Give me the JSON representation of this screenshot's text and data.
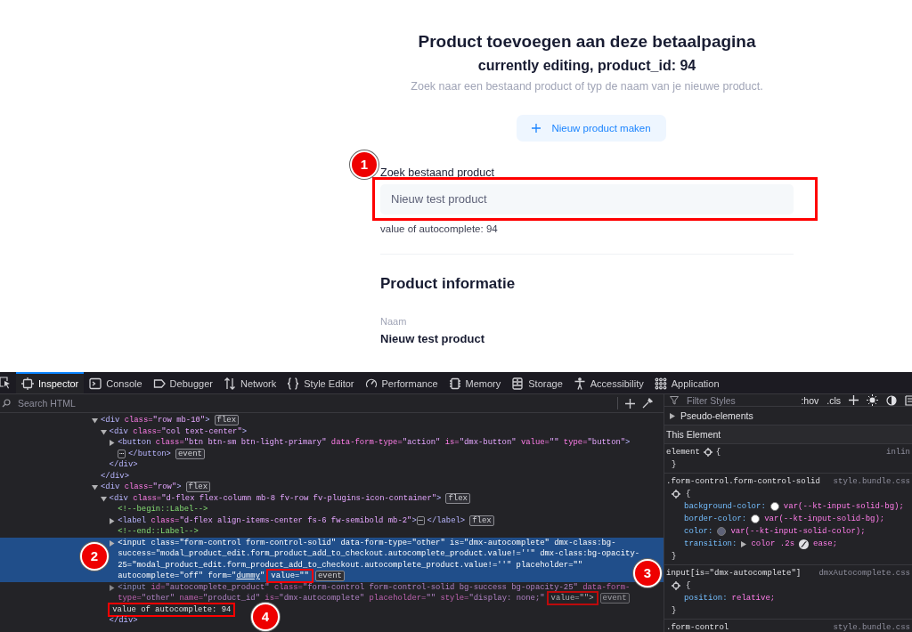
{
  "page": {
    "title": "Product toevoegen aan deze betaalpagina",
    "subtitle": "currently editing, product_id: 94",
    "description": "Zoek naar een bestaand product of typ de naam van je nieuwe product.",
    "new_button": "Nieuw product maken",
    "search_label": "Zoek bestaand product",
    "search_field": {
      "value": "Nieuw test product",
      "highlighted": true,
      "marker": "1"
    },
    "autocomplete_value": "value of autocomplete: 94",
    "section_title": "Product informatie",
    "name_label": "Naam",
    "name_value": "Nieuw test product"
  },
  "devtools": {
    "tabs": [
      {
        "kind": "inspector",
        "label": "Inspector",
        "selected": true
      },
      {
        "kind": "console",
        "label": "Console",
        "selected": false
      },
      {
        "kind": "debugger",
        "label": "Debugger",
        "selected": false
      },
      {
        "kind": "network",
        "label": "Network",
        "selected": false
      },
      {
        "kind": "style",
        "label": "Style Editor",
        "selected": false
      },
      {
        "kind": "performance",
        "label": "Performance",
        "selected": false
      },
      {
        "kind": "memory",
        "label": "Memory",
        "selected": false
      },
      {
        "kind": "storage",
        "label": "Storage",
        "selected": false
      },
      {
        "kind": "accessibility",
        "label": "Accessibility",
        "selected": false
      },
      {
        "kind": "application",
        "label": "Application",
        "selected": false
      }
    ],
    "search_placeholder": "Search HTML",
    "dom_tree": [
      {
        "kind": "element",
        "expanded": true,
        "selected": false,
        "hidden": false,
        "lines": [
          [
            {
              "kind": "tag",
              "text": "<div"
            },
            {
              "kind": "attr",
              "text": " class="
            },
            {
              "kind": "val",
              "text": "\"row mb-10\""
            },
            {
              "kind": "tag",
              "text": ">"
            },
            {
              "kind": "badge",
              "text": "flex"
            }
          ]
        ],
        "children": [
          {
            "kind": "element",
            "expanded": true,
            "selected": false,
            "hidden": false,
            "lines": [
              [
                {
                  "kind": "tag",
                  "text": "<div"
                },
                {
                  "kind": "attr",
                  "text": " class="
                },
                {
                  "kind": "val",
                  "text": "\"col text-center\""
                },
                {
                  "kind": "tag",
                  "text": ">"
                }
              ]
            ],
            "children": [
              {
                "kind": "element",
                "expanded": false,
                "selected": false,
                "hidden": false,
                "lines": [
                  [
                    {
                      "kind": "tag",
                      "text": "<button"
                    },
                    {
                      "kind": "attr",
                      "text": " class="
                    },
                    {
                      "kind": "val",
                      "text": "\"btn btn-sm btn-light-primary\""
                    },
                    {
                      "kind": "attr",
                      "text": " data-form-type="
                    },
                    {
                      "kind": "val",
                      "text": "\"action\""
                    },
                    {
                      "kind": "attr",
                      "text": " is="
                    },
                    {
                      "kind": "val",
                      "text": "\"dmx-button\""
                    },
                    {
                      "kind": "attr",
                      "text": " value="
                    },
                    {
                      "kind": "val",
                      "text": "\"\""
                    },
                    {
                      "kind": "attr",
                      "text": " type="
                    },
                    {
                      "kind": "val",
                      "text": "\"button\""
                    },
                    {
                      "kind": "tag",
                      "text": ">"
                    }
                  ],
                  [
                    {
                      "kind": "ellipsis",
                      "text": "⋯"
                    },
                    {
                      "kind": "tag",
                      "text": "</button>"
                    },
                    {
                      "kind": "badge",
                      "text": "event"
                    }
                  ]
                ]
              }
            ],
            "close": [
              {
                "kind": "tag",
                "text": "</div>"
              }
            ]
          }
        ],
        "close": [
          {
            "kind": "tag",
            "text": "</div>"
          }
        ]
      },
      {
        "kind": "element",
        "expanded": true,
        "selected": false,
        "hidden": false,
        "lines": [
          [
            {
              "kind": "tag",
              "text": "<div"
            },
            {
              "kind": "attr",
              "text": " class="
            },
            {
              "kind": "val",
              "text": "\"row\""
            },
            {
              "kind": "tag",
              "text": ">"
            },
            {
              "kind": "badge",
              "text": "flex"
            }
          ]
        ],
        "children": [
          {
            "kind": "element",
            "expanded": true,
            "selected": false,
            "hidden": false,
            "lines": [
              [
                {
                  "kind": "tag",
                  "text": "<div"
                },
                {
                  "kind": "attr",
                  "text": " class="
                },
                {
                  "kind": "val",
                  "text": "\"d-flex flex-column mb-8 fv-row fv-plugins-icon-container\""
                },
                {
                  "kind": "tag",
                  "text": ">"
                },
                {
                  "kind": "badge",
                  "text": "flex"
                }
              ]
            ],
            "children": [
              {
                "kind": "comment",
                "selected": false,
                "hidden": false,
                "lines": [
                  [
                    {
                      "kind": "comment",
                      "text": "<!--begin::Label-->"
                    }
                  ]
                ]
              },
              {
                "kind": "element",
                "expanded": false,
                "selected": false,
                "hidden": false,
                "lines": [
                  [
                    {
                      "kind": "tag",
                      "text": "<label"
                    },
                    {
                      "kind": "attr",
                      "text": " class="
                    },
                    {
                      "kind": "val",
                      "text": "\"d-flex align-items-center fs-6 fw-semibold mb-2\""
                    },
                    {
                      "kind": "tag",
                      "text": ">"
                    },
                    {
                      "kind": "ellipsis",
                      "text": "⋯"
                    },
                    {
                      "kind": "tag",
                      "text": "</label>"
                    },
                    {
                      "kind": "badge",
                      "text": "flex"
                    }
                  ]
                ]
              },
              {
                "kind": "comment",
                "selected": false,
                "hidden": false,
                "lines": [
                  [
                    {
                      "kind": "comment",
                      "text": "<!--end::Label-->"
                    }
                  ]
                ]
              },
              {
                "kind": "element",
                "expanded": false,
                "selected": true,
                "hidden": false,
                "marker": "2",
                "lines": [
                  [
                    {
                      "kind": "tag",
                      "text": "<input"
                    },
                    {
                      "kind": "attr",
                      "text": " class="
                    },
                    {
                      "kind": "val",
                      "text": "\"form-control form-control-solid\""
                    },
                    {
                      "kind": "attr",
                      "text": " data-form-type="
                    },
                    {
                      "kind": "val",
                      "text": "\"other\""
                    },
                    {
                      "kind": "attr",
                      "text": " is="
                    },
                    {
                      "kind": "val",
                      "text": "\"dmx-autocomplete\""
                    },
                    {
                      "kind": "attr",
                      "text": " dmx-class:bg-"
                    }
                  ],
                  [
                    {
                      "kind": "attr",
                      "text": "success="
                    },
                    {
                      "kind": "val",
                      "text": "\"modal_product_edit.form_product_add_to_checkout.autocomplete_product.value!=''\""
                    },
                    {
                      "kind": "attr",
                      "text": " dmx-class:bg-opacity-"
                    }
                  ],
                  [
                    {
                      "kind": "attr",
                      "text": "25="
                    },
                    {
                      "kind": "val",
                      "text": "\"modal_product_edit.form_product_add_to_checkout.autocomplete_product.value!=''\""
                    },
                    {
                      "kind": "attr",
                      "text": " placeholder="
                    },
                    {
                      "kind": "val",
                      "text": "\"\""
                    }
                  ],
                  [
                    {
                      "kind": "attr",
                      "text": "autocomplete="
                    },
                    {
                      "kind": "val",
                      "text": "\"off\""
                    },
                    {
                      "kind": "attr",
                      "text": " form="
                    },
                    {
                      "kind": "val",
                      "text": "\""
                    },
                    {
                      "kind": "link",
                      "text": "dummy"
                    },
                    {
                      "kind": "val",
                      "text": "\""
                    },
                    {
                      "kind": "mark",
                      "text": "value=\"\""
                    },
                    {
                      "kind": "badge",
                      "text": "event"
                    }
                  ]
                ]
              },
              {
                "kind": "element",
                "expanded": false,
                "selected": false,
                "hidden": true,
                "lines": [
                  [
                    {
                      "kind": "tag",
                      "text": "<input"
                    },
                    {
                      "kind": "attr",
                      "text": " id="
                    },
                    {
                      "kind": "val",
                      "text": "\"autocomplete_product\""
                    },
                    {
                      "kind": "attr",
                      "text": " class="
                    },
                    {
                      "kind": "val",
                      "text": "\"form-control form-control-solid bg-success bg-opacity-25\""
                    },
                    {
                      "kind": "attr",
                      "text": " data-form-"
                    }
                  ],
                  [
                    {
                      "kind": "attr",
                      "text": "type="
                    },
                    {
                      "kind": "val",
                      "text": "\"other\""
                    },
                    {
                      "kind": "attr",
                      "text": " name="
                    },
                    {
                      "kind": "val",
                      "text": "\"product_id\""
                    },
                    {
                      "kind": "attr",
                      "text": " is="
                    },
                    {
                      "kind": "val",
                      "text": "\"dmx-autocomplete\""
                    },
                    {
                      "kind": "attr",
                      "text": " placeholder="
                    },
                    {
                      "kind": "val",
                      "text": "\"\""
                    },
                    {
                      "kind": "attr",
                      "text": " style="
                    },
                    {
                      "kind": "val",
                      "text": "\"display: none;\""
                    },
                    {
                      "kind": "mark",
                      "text": "value=\"\">",
                      "marker": "3"
                    },
                    {
                      "kind": "badge",
                      "text": "event"
                    }
                  ]
                ]
              },
              {
                "kind": "text",
                "selected": false,
                "hidden": false,
                "lines": [
                  [
                    {
                      "kind": "mark",
                      "text": "value of autocomplete: 94",
                      "marker": "4"
                    }
                  ]
                ]
              }
            ],
            "close": [
              {
                "kind": "tag",
                "text": "</div>"
              }
            ]
          }
        ]
      }
    ],
    "rules_toolbar": {
      "filter_placeholder": "Filter Styles",
      "hov": ":hov",
      "cls": ".cls"
    },
    "pseudo_elements": {
      "label": "Pseudo-elements",
      "expanded": false
    },
    "this_element": "This Element",
    "rules": [
      {
        "selector": "element",
        "source": "inlin",
        "open": "{",
        "close": "}"
      },
      {
        "selector": ".form-control.form-control-solid",
        "source": "style.bundle.css",
        "open": "{",
        "close": "}",
        "declarations": [
          {
            "kind": "color",
            "property": "background-color:",
            "color": "#ffffff",
            "value": "var(--kt-input-solid-bg);"
          },
          {
            "kind": "color",
            "property": "border-color:",
            "color": "#ffffff",
            "value": "var(--kt-input-solid-bg);"
          },
          {
            "kind": "color",
            "property": "color:",
            "color": "#5e6278",
            "value": "var(--kt-input-solid-color);"
          },
          {
            "kind": "transition",
            "property": "transition:",
            "value": "color .2s",
            "easing": "ease;"
          }
        ]
      },
      {
        "selector": "input[is=\"dmx-autocomplete\"]",
        "source": "dmxAutocomplete.css",
        "open": "{",
        "close": "}",
        "declarations": [
          {
            "kind": "plain",
            "property": "position:",
            "value": "relative;"
          }
        ]
      },
      {
        "selector": ".form-control",
        "source": "style.bundle.css"
      }
    ]
  }
}
